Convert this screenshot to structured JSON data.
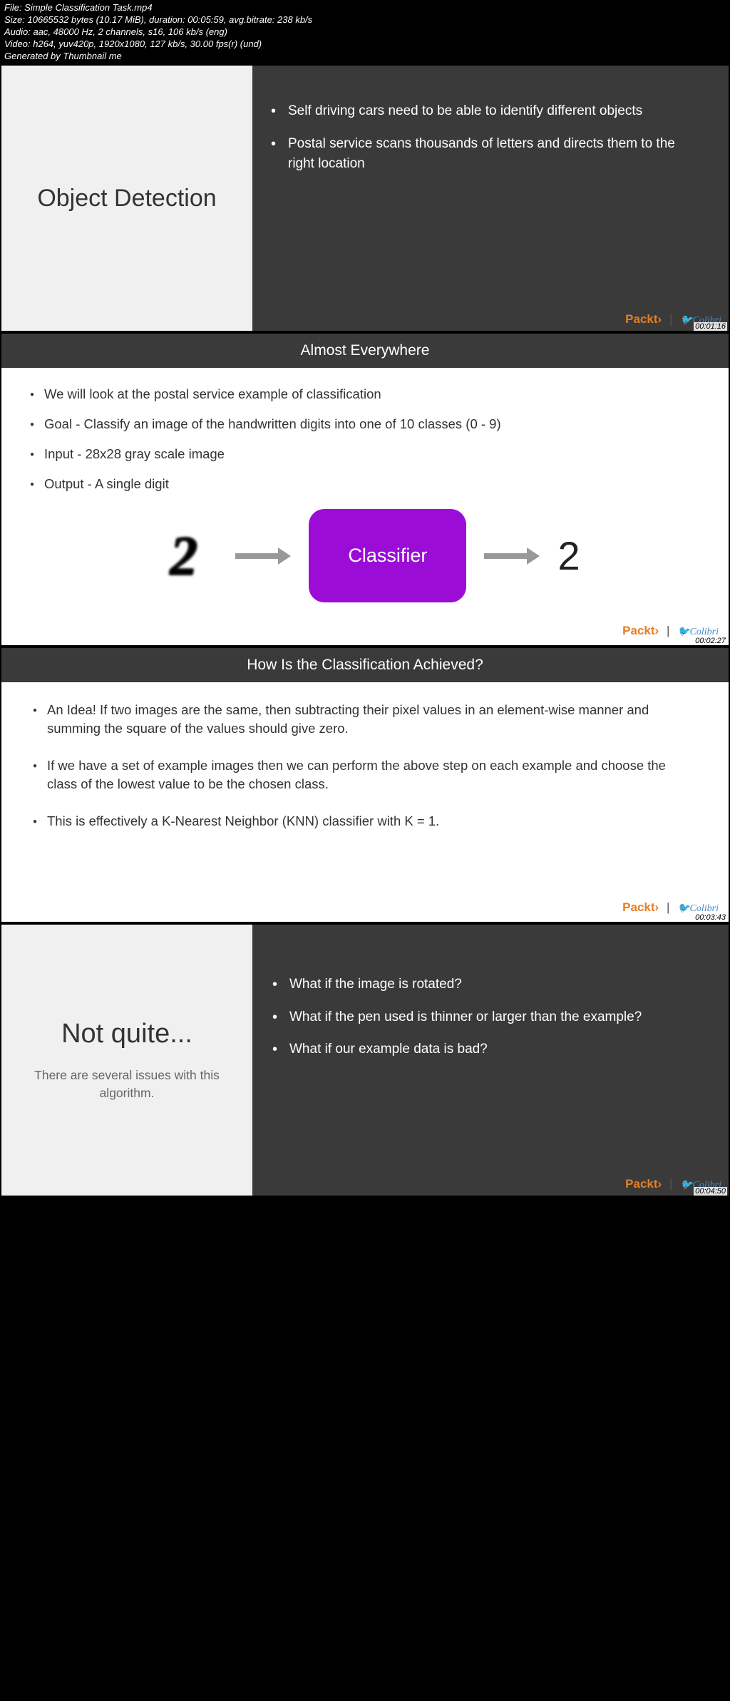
{
  "metadata": {
    "file": "File: Simple Classification Task.mp4",
    "size": "Size: 10665532 bytes (10.17 MiB), duration: 00:05:59, avg.bitrate: 238 kb/s",
    "audio": "Audio: aac, 48000 Hz, 2 channels, s16, 106 kb/s (eng)",
    "video": "Video: h264, yuv420p, 1920x1080, 127 kb/s, 30.00 fps(r) (und)",
    "generated": "Generated by Thumbnail me"
  },
  "brand": {
    "packt": "Packt›",
    "colibri": "Colibri"
  },
  "slide1": {
    "title": "Object Detection",
    "bullets": [
      "Self driving cars need to be able to identify different objects",
      "Postal service scans thousands of letters and directs them to the right location"
    ],
    "timestamp": "00:01:16"
  },
  "slide2": {
    "header": "Almost Everywhere",
    "bullets": [
      "We will look at the postal service example of classification",
      "Goal - Classify an image of the handwritten digits into one of 10 classes (0 - 9)",
      "Input - 28x28 gray scale image",
      "Output - A single digit"
    ],
    "diagram": {
      "input": "2",
      "box": "Classifier",
      "output": "2"
    },
    "timestamp": "00:02:27"
  },
  "slide3": {
    "header": "How Is the Classification Achieved?",
    "bullets": [
      "An Idea! If two images are the same, then subtracting their pixel values in an element-wise manner and summing the square of the values should give zero.",
      "If we have a set of example images then we can perform the above step on each example and choose the class of the lowest value to be the chosen class.",
      "This is effectively a K-Nearest Neighbor (KNN) classifier with K = 1."
    ],
    "timestamp": "00:03:43"
  },
  "slide4": {
    "title": "Not quite...",
    "subtitle": "There are several issues with this algorithm.",
    "bullets": [
      "What if the image is rotated?",
      "What if the pen used is thinner or larger than the example?",
      "What if our example data is bad?"
    ],
    "timestamp": "00:04:50"
  }
}
